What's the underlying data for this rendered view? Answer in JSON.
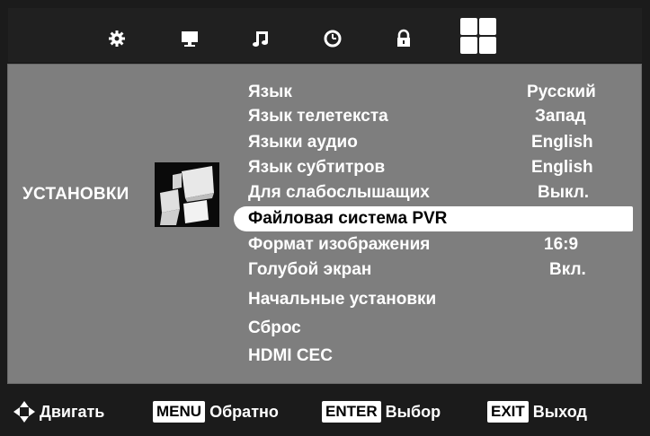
{
  "tabs": [
    {
      "icon": "gear-icon"
    },
    {
      "icon": "monitor-icon"
    },
    {
      "icon": "music-note-icon"
    },
    {
      "icon": "clock-icon"
    },
    {
      "icon": "lock-icon"
    },
    {
      "icon": "grid-icon",
      "active": true
    }
  ],
  "category": {
    "label": "УСТАНОВКИ",
    "icon": "setup-tiles-icon"
  },
  "menu": {
    "items": [
      {
        "label": "Язык",
        "value": "Русский"
      },
      {
        "label": "Язык телетекста",
        "value": "Запад"
      },
      {
        "label": "Языки аудио",
        "value": "English"
      },
      {
        "label": "Язык субтитров",
        "value": "English"
      },
      {
        "label": "Для слабослышащих",
        "value": "Выкл."
      },
      {
        "label": "Файловая система PVR",
        "value": "",
        "selected": true
      },
      {
        "label": "Формат изображения",
        "value": "16:9"
      },
      {
        "label": "Голубой экран",
        "value": "Вкл."
      },
      {
        "label": "Начальные установки",
        "value": ""
      },
      {
        "label": "Сброс",
        "value": ""
      },
      {
        "label": "HDMI CEC",
        "value": ""
      }
    ]
  },
  "footer": {
    "move_label": "Двигать",
    "menu_key": "MENU",
    "back_label": "Обратно",
    "enter_key": "ENTER",
    "select_label": "Выбор",
    "exit_key": "EXIT",
    "exit_label": "Выход"
  },
  "colors": {
    "panel": "#7e7e7e",
    "bar": "#1b1b1b",
    "highlight": "#ffffff",
    "text": "#ffffff"
  }
}
